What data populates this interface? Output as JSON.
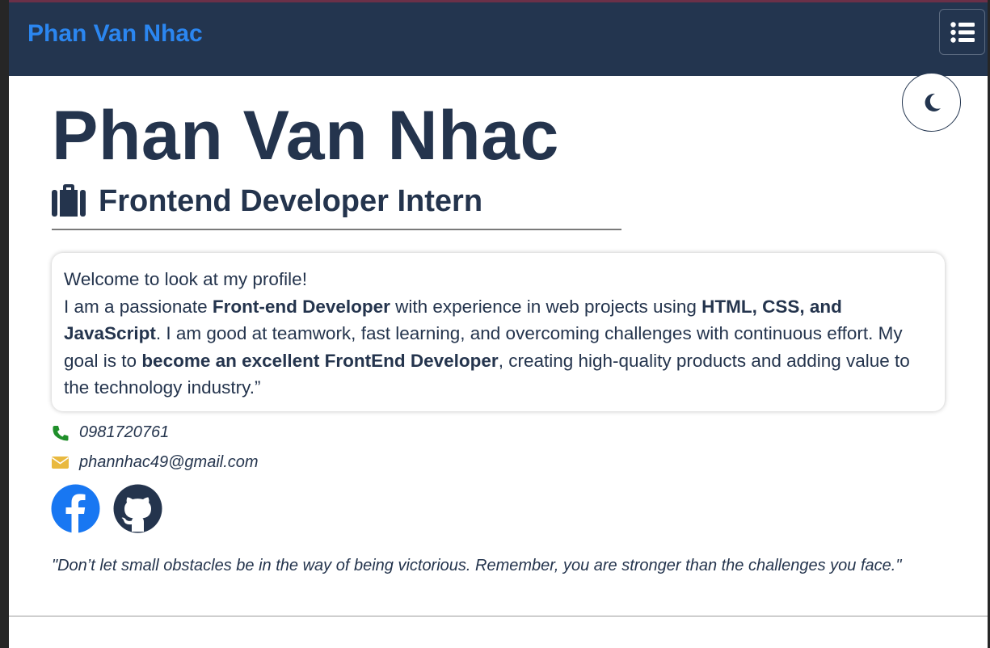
{
  "navbar": {
    "brand": "Phan Van Nhac",
    "menu_icon": "list-icon"
  },
  "theme_toggle": {
    "icon": "moon-icon"
  },
  "hero": {
    "name": "Phan Van Nhac",
    "role_icon": "briefcase-icon",
    "role": "Frontend Developer Intern"
  },
  "intro": {
    "line1": "Welcome to look at my profile!",
    "p2_a": "I am a passionate ",
    "p2_b": "Front-end Developer",
    "p2_c": " with experience in web projects using ",
    "p2_d": "HTML, CSS, and JavaScript",
    "p2_e": ". I am good at teamwork, fast learning, and overcoming challenges with continuous effort. My goal is to ",
    "p2_f": "become an excellent FrontEnd Developer",
    "p2_g": ", creating high-quality products and adding value to the technology industry.”"
  },
  "contact": {
    "phone_icon": "phone-icon",
    "phone": "0981720761",
    "email_icon": "envelope-icon",
    "email": "phannhac49@gmail.com"
  },
  "social": {
    "facebook_icon": "facebook-icon",
    "github_icon": "github-icon"
  },
  "quote": "\"Don’t let small obstacles be in the way of being victorious. Remember, you are stronger than the challenges you face.\"",
  "colors": {
    "navbar_bg": "#23354f",
    "brand": "#2b86f0",
    "text": "#24344d",
    "phone_green": "#1f8f2a",
    "mail_yellow": "#e9b93f",
    "facebook_blue": "#1877f2"
  }
}
